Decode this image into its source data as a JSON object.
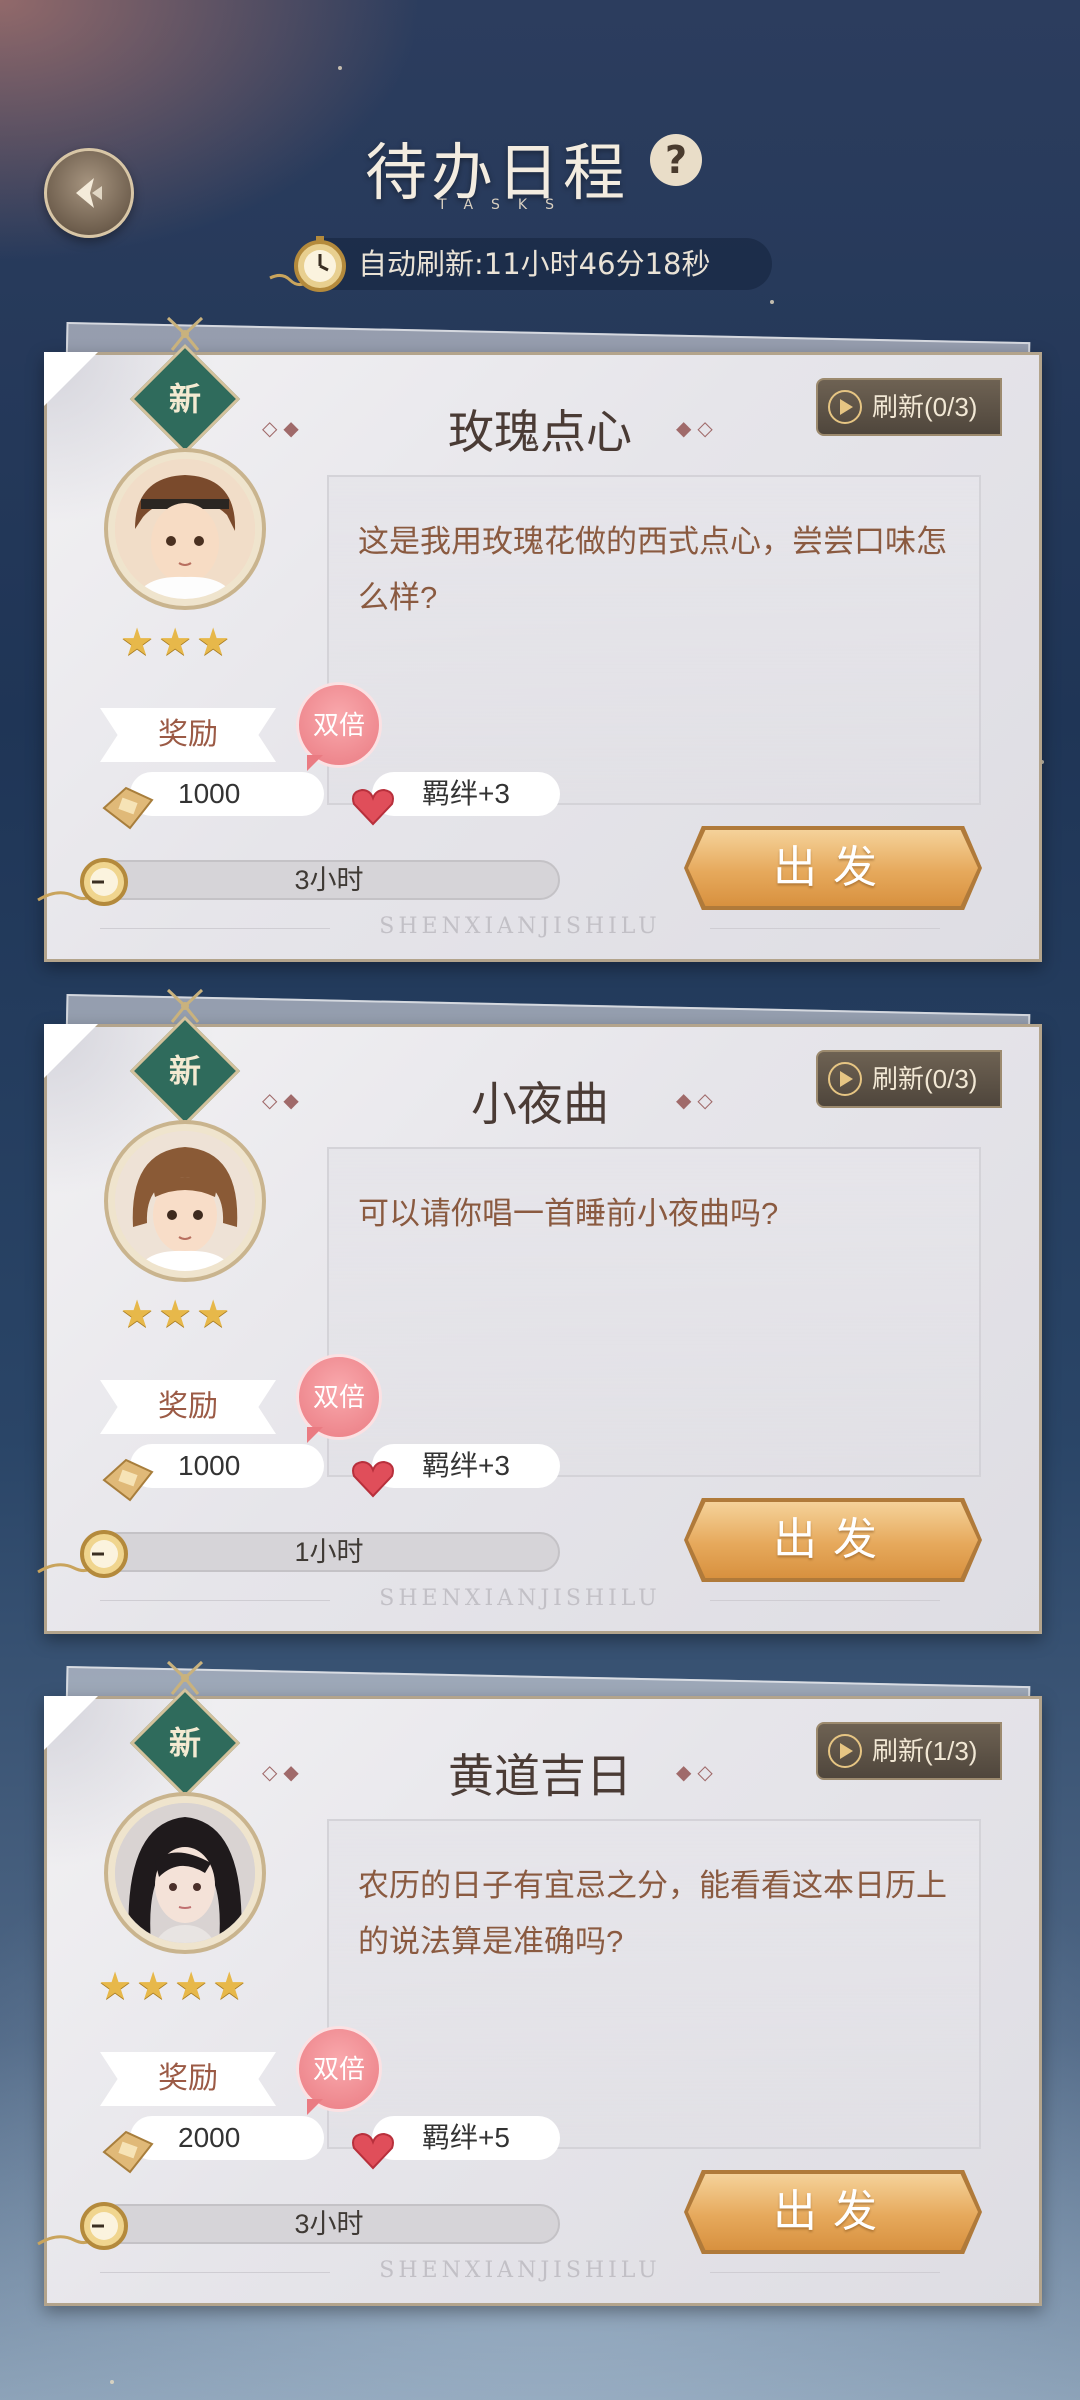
{
  "header": {
    "title": "待办日程",
    "subtitle": "TASKS",
    "help_symbol": "?",
    "auto_refresh": "自动刷新:11小时46分18秒"
  },
  "colors": {
    "accent_gold": "#e6a95c",
    "badge_green": "#2f6b5c",
    "double_pink": "#ea7b82"
  },
  "tasks": [
    {
      "new_label": "新",
      "title": "玫瑰点心",
      "refresh": "刷新(0/3)",
      "description": "这是我用玫瑰花做的西式点心，尝尝口味怎么样?",
      "stars": "★★★",
      "star_count": 3,
      "reward_label": "奖励",
      "double_label": "双倍",
      "coins": "1000",
      "bond": "羁绊+3",
      "duration": "3小时",
      "go_label": "出发",
      "footer": "SHENXIANJISHILU",
      "avatar": "boy-headband-portrait"
    },
    {
      "new_label": "新",
      "title": "小夜曲",
      "refresh": "刷新(0/3)",
      "description": "可以请你唱一首睡前小夜曲吗?",
      "stars": "★★★",
      "star_count": 3,
      "reward_label": "奖励",
      "double_label": "双倍",
      "coins": "1000",
      "bond": "羁绊+3",
      "duration": "1小时",
      "go_label": "出发",
      "footer": "SHENXIANJISHILU",
      "avatar": "short-hair-portrait"
    },
    {
      "new_label": "新",
      "title": "黄道吉日",
      "refresh": "刷新(1/3)",
      "description": "农历的日子有宜忌之分，能看看这本日历上的说法算是准确吗?",
      "stars": "★★★★",
      "star_count": 4,
      "reward_label": "奖励",
      "double_label": "双倍",
      "coins": "2000",
      "bond": "羁绊+5",
      "duration": "3小时",
      "go_label": "出发",
      "footer": "SHENXIANJISHILU",
      "avatar": "long-hair-portrait"
    }
  ]
}
